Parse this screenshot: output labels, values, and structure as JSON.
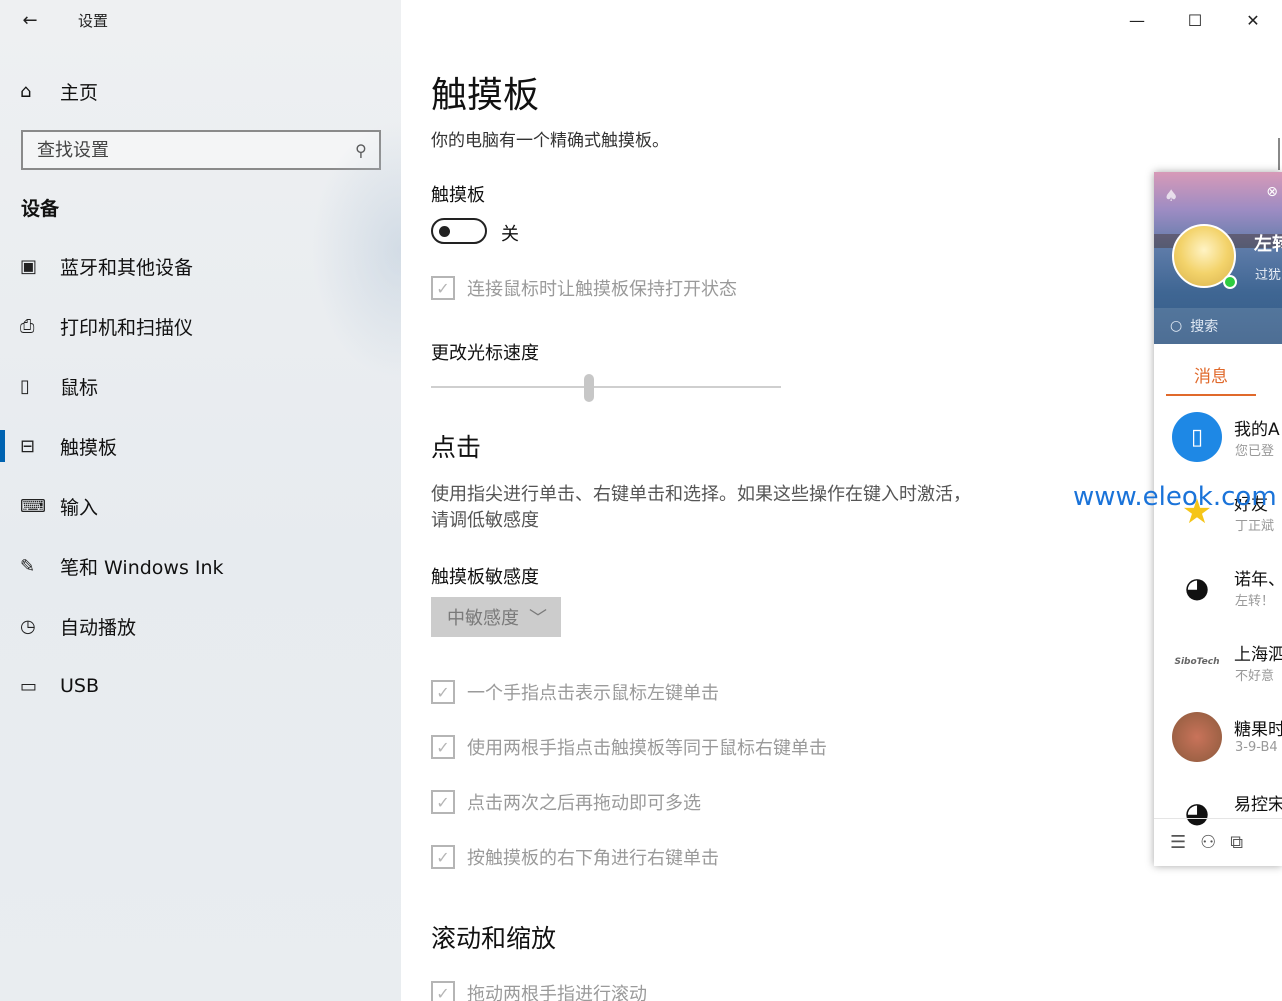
{
  "window": {
    "title": "设置",
    "back": "←",
    "minimize": "—",
    "maximize": "☐",
    "close": "✕"
  },
  "sidebar": {
    "home_label": "主页",
    "search_placeholder": "查找设置",
    "section": "设备",
    "items": [
      {
        "label": "蓝牙和其他设备",
        "icon": "bluetooth-devices-icon"
      },
      {
        "label": "打印机和扫描仪",
        "icon": "printer-icon"
      },
      {
        "label": "鼠标",
        "icon": "mouse-icon"
      },
      {
        "label": "触摸板",
        "icon": "touchpad-icon",
        "active": true
      },
      {
        "label": "输入",
        "icon": "keyboard-icon"
      },
      {
        "label": "笔和 Windows Ink",
        "icon": "pen-icon"
      },
      {
        "label": "自动播放",
        "icon": "autoplay-icon"
      },
      {
        "label": "USB",
        "icon": "usb-icon"
      }
    ],
    "active_color": "#0063b1"
  },
  "main": {
    "title": "触摸板",
    "description": "你的电脑有一个精确式触摸板。",
    "touchpad_label": "触摸板",
    "toggle_state": "关",
    "keep_on_with_mouse": "连接鼠标时让触摸板保持打开状态",
    "cursor_speed_label": "更改光标速度",
    "cursor_speed_value": 0.45,
    "taps_heading": "点击",
    "taps_description": "使用指尖进行单击、右键单击和选择。如果这些操作在键入时激活，请调低敏感度",
    "sensitivity_label": "触摸板敏感度",
    "sensitivity_value": "中敏感度",
    "options": [
      "一个手指点击表示鼠标左键单击",
      "使用两根手指点击触摸板等同于鼠标右键单击",
      "点击两次之后再拖动即可多选",
      "按触摸板的右下角进行右键单击"
    ],
    "scroll_heading": "滚动和缩放",
    "scroll_option": "拖动两根手指进行滚动"
  },
  "qq": {
    "name": "左转",
    "signature": "过犹",
    "search": "搜索",
    "tab": "消息",
    "tab_color": "#e0692b",
    "contacts": [
      {
        "name": "我的A",
        "msg": "您已登"
      },
      {
        "name": "好友",
        "msg": "丁正斌"
      },
      {
        "name": "诺年、",
        "msg": "左转！"
      },
      {
        "name": "上海泗",
        "msg": "不好意"
      },
      {
        "name": "糖果时",
        "msg": "3-9-B4"
      },
      {
        "name": "易控宋",
        "msg": ""
      }
    ],
    "sibotech": "SiboTech"
  },
  "watermark": "www.eleok.com"
}
